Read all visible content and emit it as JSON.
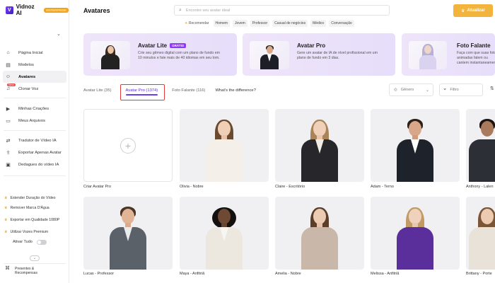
{
  "app": {
    "name": "Vidnoz AI",
    "badge": "ENTERPRISE",
    "page_title": "Avatares",
    "upgrade_label": "Atualizar"
  },
  "search": {
    "placeholder": "Encontre seu avatar ideal"
  },
  "chips": {
    "recommend_label": "Recomendar",
    "items": [
      "Homem",
      "Jovem",
      "Professor",
      "Casual de negócios",
      "Médico",
      "Conversação"
    ]
  },
  "sidebar": {
    "nav": [
      {
        "label": "Página Inicial",
        "icon": "home-icon"
      },
      {
        "label": "Modelos",
        "icon": "template-icon"
      },
      {
        "label": "Avatares",
        "icon": "avatar-icon",
        "active": true
      },
      {
        "label": "Clonar Voz",
        "icon": "voice-icon",
        "badge": "Novo"
      }
    ],
    "nav2": [
      {
        "label": "Minhas Criações",
        "icon": "play-icon"
      },
      {
        "label": "Meus Arquivos",
        "icon": "folder-icon"
      }
    ],
    "nav3": [
      {
        "label": "Tradutor de Vídeo IA",
        "icon": "translate-icon"
      },
      {
        "label": "Exportar Apenas Avatar",
        "icon": "export-icon"
      },
      {
        "label": "Dedagues do vídeo IA",
        "icon": "video-icon"
      }
    ],
    "premium": [
      "Estender Duração do Vídeo",
      "Remover Marca D'Água",
      "Exportar em Qualidade 1080P",
      "Utilizar Vozes Premium"
    ],
    "toggle_label": "Ativar Tudo",
    "gift_label_1": "Presentes &",
    "gift_label_2": "Recompensas"
  },
  "promos": [
    {
      "title": "Avatar Lite",
      "badge": "GRÁTIS",
      "desc": "Crie seu gêmeo digital com um plano de fundo em 10 minutos e fale mais de 40 idiomas em seu tom."
    },
    {
      "title": "Avatar Pro",
      "badge": "",
      "desc": "Gere um avatar de IA de nível profissional em um plano de fundo em 3 dias."
    },
    {
      "title": "Foto Falante",
      "badge": "",
      "desc": "Faça com que suas fotos animadas falem ou cantem instantaneamente"
    }
  ],
  "tabs": {
    "items": [
      "Avatar Lite (35)",
      "Avatar Pro (1374)",
      "Foto Falante (116)"
    ],
    "diff_label": "What's the difference?",
    "active_index": 1
  },
  "filters": {
    "gender_label": "Gênero",
    "filter_label": "Filtro"
  },
  "grid": {
    "create_label": "Criar Avatar Pro",
    "avatars": [
      {
        "label": "Olivia - Nobre"
      },
      {
        "label": "Claire - Escritório"
      },
      {
        "label": "Adam - Terno"
      },
      {
        "label": "Anthony - Lalen"
      },
      {
        "label": "Lucas - Professor"
      },
      {
        "label": "Maya - Anfitriã"
      },
      {
        "label": "Amelia - Nobre"
      },
      {
        "label": "Melissa - Anfitriã"
      },
      {
        "label": "Brittany - Porte"
      }
    ]
  }
}
